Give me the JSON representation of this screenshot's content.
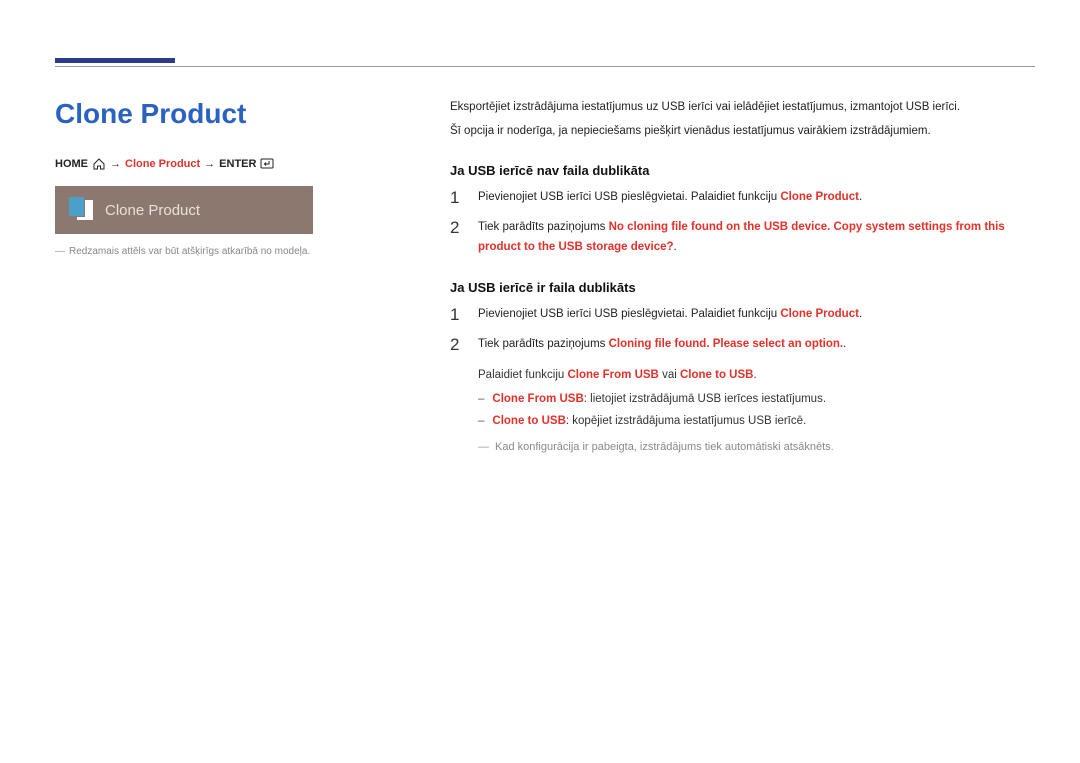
{
  "title": "Clone Product",
  "breadcrumb": {
    "home": "HOME",
    "arrow": "→",
    "item": "Clone Product",
    "enter": "ENTER"
  },
  "screenshot_label": "Clone Product",
  "image_note": "Redzamais attēls var būt atšķirīgs atkarībā no modeļa.",
  "intro": {
    "p1": "Eksportējiet izstrādājuma iestatījumus uz USB ierīci vai ielādējiet iestatījumus, izmantojot USB ierīci.",
    "p2": "Šī opcija ir noderīga, ja nepieciešams piešķirt vienādus iestatījumus vairākiem izstrādājumiem."
  },
  "section1": {
    "heading": "Ja USB ierīcē nav faila dublikāta",
    "step1_num": "1",
    "step1_text_a": "Pievienojiet USB ierīci USB pieslēgvietai. Palaidiet funkciju ",
    "step1_text_b": "Clone Product",
    "step1_text_c": ".",
    "step2_num": "2",
    "step2_text_a": "Tiek parādīts paziņojums ",
    "step2_text_b": "No cloning file found on the USB device. Copy system settings from this product to the USB storage device?",
    "step2_text_c": "."
  },
  "section2": {
    "heading": "Ja USB ierīcē ir faila dublikāts",
    "step1_num": "1",
    "step1_text_a": "Pievienojiet USB ierīci USB pieslēgvietai. Palaidiet funkciju ",
    "step1_text_b": "Clone Product",
    "step1_text_c": ".",
    "step2_num": "2",
    "step2_text_a": "Tiek parādīts paziņojums ",
    "step2_text_b": "Cloning file found. Please select an option.",
    "step2_text_c": ".",
    "follow_a": "Palaidiet funkciju ",
    "follow_b": "Clone From USB",
    "follow_c": " vai ",
    "follow_d": "Clone to USB",
    "follow_e": ".",
    "bullet1_a": "Clone From USB",
    "bullet1_b": ": lietojiet izstrādājumā USB ierīces iestatījumus.",
    "bullet2_a": "Clone to USB",
    "bullet2_b": ": kopējiet izstrādājuma iestatījumus USB ierīcē.",
    "footnote": "Kad konfigurācija ir pabeigta, izstrādājums tiek automātiski atsāknēts."
  }
}
